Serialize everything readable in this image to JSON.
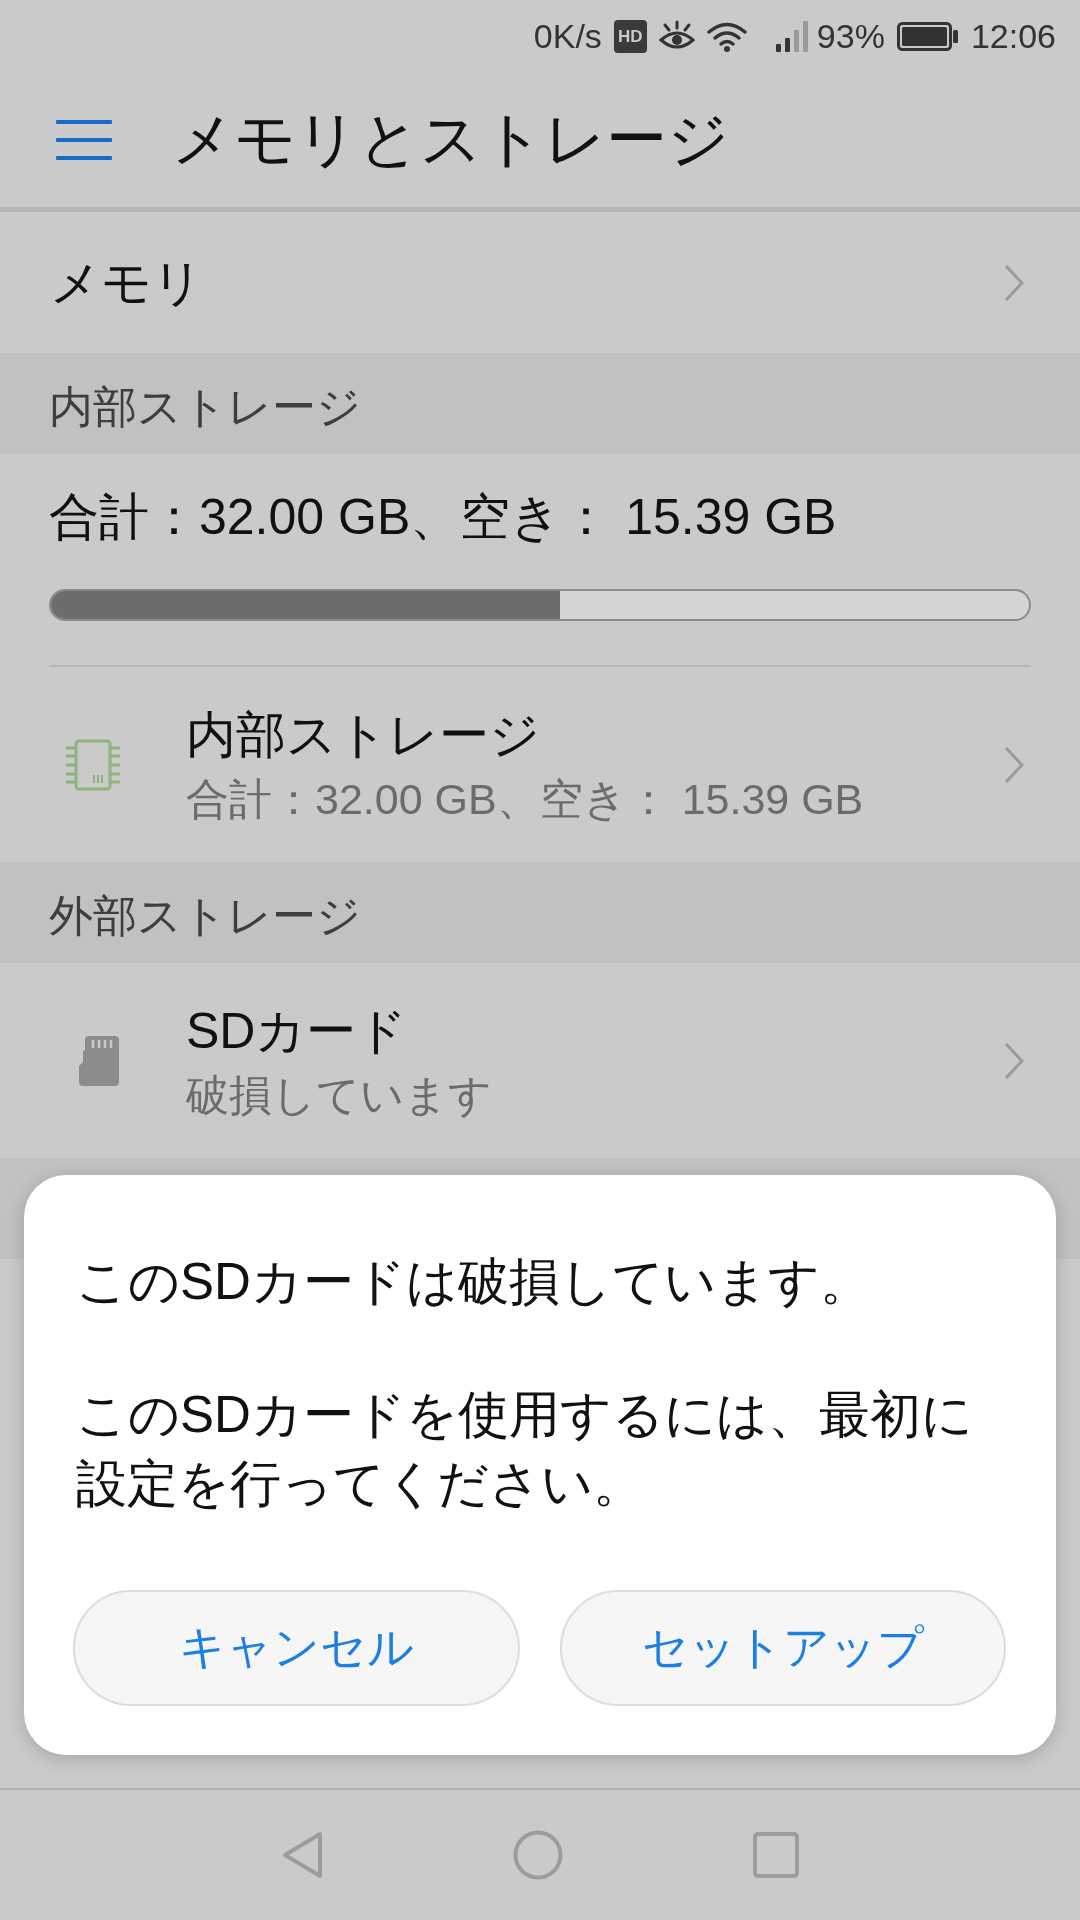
{
  "status_bar": {
    "speed": "0K/s",
    "hd_badge": "HD",
    "battery_percent": "93%",
    "time": "12:06"
  },
  "app_bar": {
    "title": "メモリとストレージ"
  },
  "memory_row": {
    "label": "メモリ"
  },
  "sections": [
    {
      "header": "内部ストレージ",
      "summary": "合計：32.00 GB、空き： 15.39 GB",
      "usage": {
        "level": 0.52
      },
      "items": [
        {
          "kind": "internal",
          "title": "内部ストレージ",
          "subtitle": "合計：32.00 GB、空き： 15.39 GB"
        }
      ]
    },
    {
      "header": "外部ストレージ",
      "items": [
        {
          "kind": "sd",
          "title": "SDカード",
          "subtitle": "破損しています"
        }
      ]
    }
  ],
  "dialog": {
    "message": "このSDカードは破損しています。",
    "detail": "このSDカードを使用するには、最初に設定を行ってください。",
    "buttons": [
      {
        "label": "キャンセル"
      },
      {
        "label": "セットアップ"
      }
    ]
  }
}
